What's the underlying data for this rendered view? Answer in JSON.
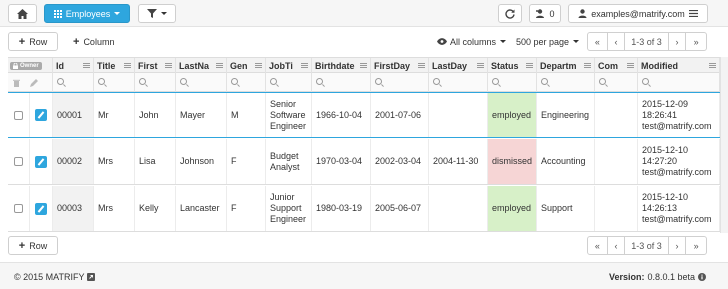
{
  "navbar": {
    "view_label": "Employees",
    "user_count": "0",
    "user_email": "examples@matrify.com"
  },
  "toolbar": {
    "add_row_label": "Row",
    "add_column_label": "Column",
    "columns_label": "All columns",
    "per_page_label": "500 per page",
    "page_info": "1-3 of 3"
  },
  "grid": {
    "owner_label": "Owner",
    "columns": [
      "Id",
      "Title",
      "First",
      "LastNa",
      "Gen",
      "JobTi",
      "Birthdate",
      "FirstDay",
      "LastDay",
      "Status",
      "Departm",
      "Com",
      "Modified"
    ],
    "rows": [
      {
        "id": "00001",
        "title": "Mr",
        "first": "John",
        "last": "Mayer",
        "gender": "M",
        "job1": "Senior",
        "job2": "Software",
        "job3": "Engineer",
        "birth": "1966-10-04",
        "firstday": "2001-07-06",
        "lastday": "",
        "status": "employed",
        "dept": "Engineering",
        "comment": "",
        "mod1": "2015-12-09",
        "mod2": "18:26:41",
        "mod3": "test@matrify.com"
      },
      {
        "id": "00002",
        "title": "Mrs",
        "first": "Lisa",
        "last": "Johnson",
        "gender": "F",
        "job1": "Budget",
        "job2": "Analyst",
        "job3": "",
        "birth": "1970-03-04",
        "firstday": "2002-03-04",
        "lastday": "2004-11-30",
        "status": "dismissed",
        "dept": "Accounting",
        "comment": "",
        "mod1": "2015-12-10",
        "mod2": "14:27:20",
        "mod3": "test@matrify.com"
      },
      {
        "id": "00003",
        "title": "Mrs",
        "first": "Kelly",
        "last": "Lancaster",
        "gender": "F",
        "job1": "Junior",
        "job2": "Support",
        "job3": "Engineer",
        "birth": "1980-03-19",
        "firstday": "2005-06-07",
        "lastday": "",
        "status": "employed",
        "dept": "Support",
        "comment": "",
        "mod1": "2015-12-10",
        "mod2": "14:26:13",
        "mod3": "test@matrify.com"
      }
    ]
  },
  "bottom": {
    "add_row_label": "Row",
    "page_info": "1-3 of 3"
  },
  "footer": {
    "copyright": "© 2015 MATRIFY",
    "version_label": "Version:",
    "version_value": "0.8.0.1 beta"
  },
  "colors": {
    "accent": "#2ea6de",
    "employed": "#d7f0c8",
    "dismissed": "#f6d5d5"
  }
}
